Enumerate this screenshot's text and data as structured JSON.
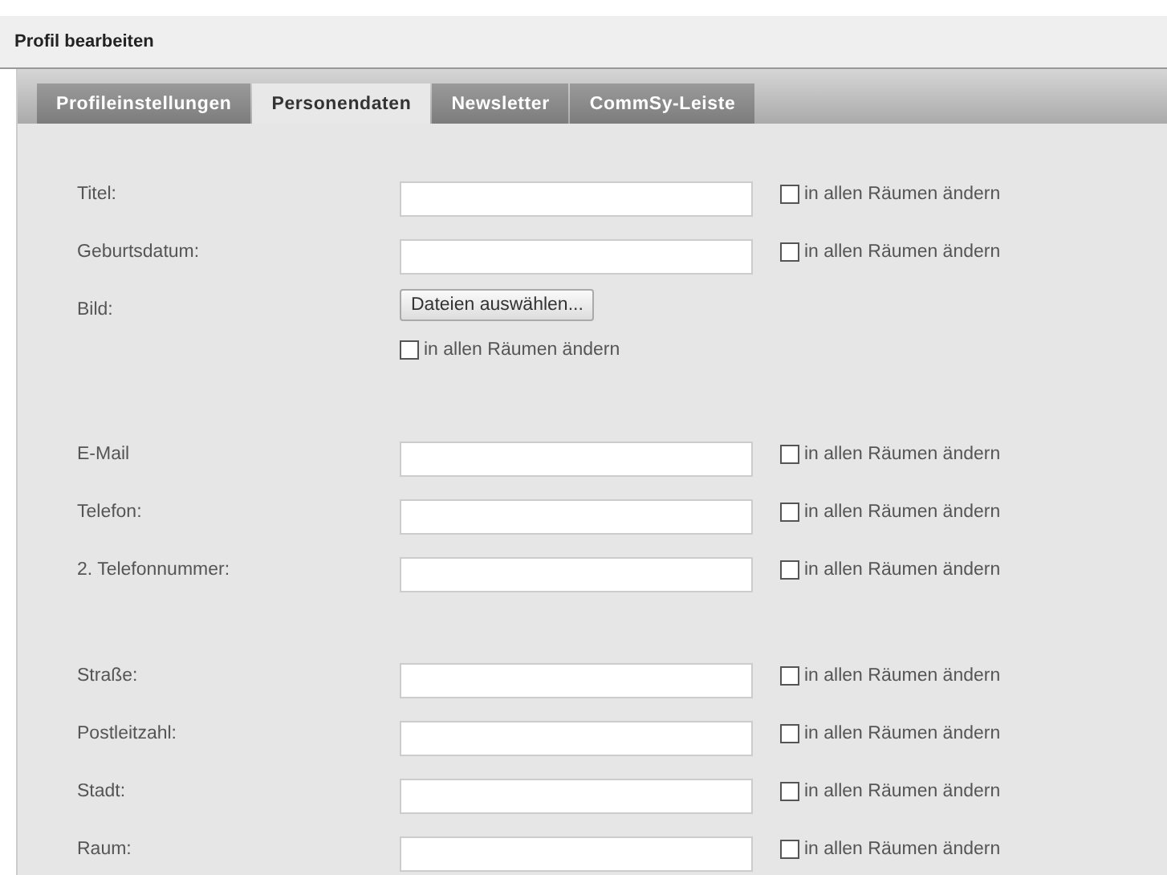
{
  "header": {
    "title": "Profil bearbeiten"
  },
  "tabs": [
    {
      "label": "Profileinstellungen",
      "selected": false
    },
    {
      "label": "Personendaten",
      "selected": true
    },
    {
      "label": "Newsletter",
      "selected": false
    },
    {
      "label": "CommSy-Leiste",
      "selected": false
    }
  ],
  "groups": [
    {
      "rows": [
        {
          "kind": "text",
          "label": "Titel:",
          "all_rooms": {
            "label": "in allen Räumen ändern",
            "checked": false
          }
        },
        {
          "kind": "text",
          "label": "Geburtsdatum:",
          "all_rooms": {
            "label": "in allen Räumen ändern",
            "checked": false
          }
        },
        {
          "kind": "file",
          "label": "Bild:",
          "button": "Dateien auswählen...",
          "all_rooms": {
            "label": "in allen Räumen ändern",
            "checked": false
          }
        }
      ]
    },
    {
      "rows": [
        {
          "kind": "text",
          "label": "E-Mail",
          "all_rooms": {
            "label": "in allen Räumen ändern",
            "checked": false
          }
        },
        {
          "kind": "text",
          "label": "Telefon:",
          "all_rooms": {
            "label": "in allen Räumen ändern",
            "checked": false
          }
        },
        {
          "kind": "text",
          "label": "2. Telefonnummer:",
          "all_rooms": {
            "label": "in allen Räumen ändern",
            "checked": false
          }
        }
      ]
    },
    {
      "rows": [
        {
          "kind": "text",
          "label": "Straße:",
          "all_rooms": {
            "label": "in allen Räumen ändern",
            "checked": false
          }
        },
        {
          "kind": "text",
          "label": "Postleitzahl:",
          "all_rooms": {
            "label": "in allen Räumen ändern",
            "checked": false
          }
        },
        {
          "kind": "text",
          "label": "Stadt:",
          "all_rooms": {
            "label": "in allen Räumen ändern",
            "checked": false
          }
        },
        {
          "kind": "text",
          "label": "Raum:",
          "all_rooms": {
            "label": "in allen Räumen ändern",
            "checked": false
          }
        }
      ]
    }
  ]
}
